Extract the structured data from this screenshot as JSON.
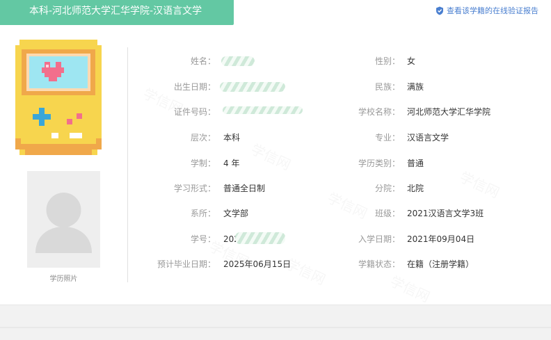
{
  "header": {
    "title": "本科-河北师范大学汇华学院-汉语言文学",
    "verify_link": "查看该学籍的在线验证报告",
    "title_bg": "#63c8a3"
  },
  "watermark": "学信网",
  "photo": {
    "caption": "学历照片"
  },
  "fields_left": [
    {
      "label": "姓名：",
      "value": ""
    },
    {
      "label": "出生日期：",
      "value": ""
    },
    {
      "label": "证件号码：",
      "value": ""
    },
    {
      "label": "层次：",
      "value": "本科"
    },
    {
      "label": "学制：",
      "value": "4 年"
    },
    {
      "label": "学习形式：",
      "value": "普通全日制"
    },
    {
      "label": "系所：",
      "value": "文学部"
    },
    {
      "label": "学号：",
      "value": "202"
    },
    {
      "label": "预计毕业日期：",
      "value": "2025年06月15日"
    }
  ],
  "fields_right": [
    {
      "label": "性别：",
      "value": "女"
    },
    {
      "label": "民族：",
      "value": "满族"
    },
    {
      "label": "学校名称：",
      "value": "河北师范大学汇华学院"
    },
    {
      "label": "专业：",
      "value": "汉语言文学"
    },
    {
      "label": "学历类别：",
      "value": "普通"
    },
    {
      "label": "分院：",
      "value": "北院"
    },
    {
      "label": "班级：",
      "value": "2021汉语言文学3班"
    },
    {
      "label": "入学日期：",
      "value": "2021年09月04日"
    },
    {
      "label": "学籍状态：",
      "value": "在籍（注册学籍）"
    }
  ]
}
